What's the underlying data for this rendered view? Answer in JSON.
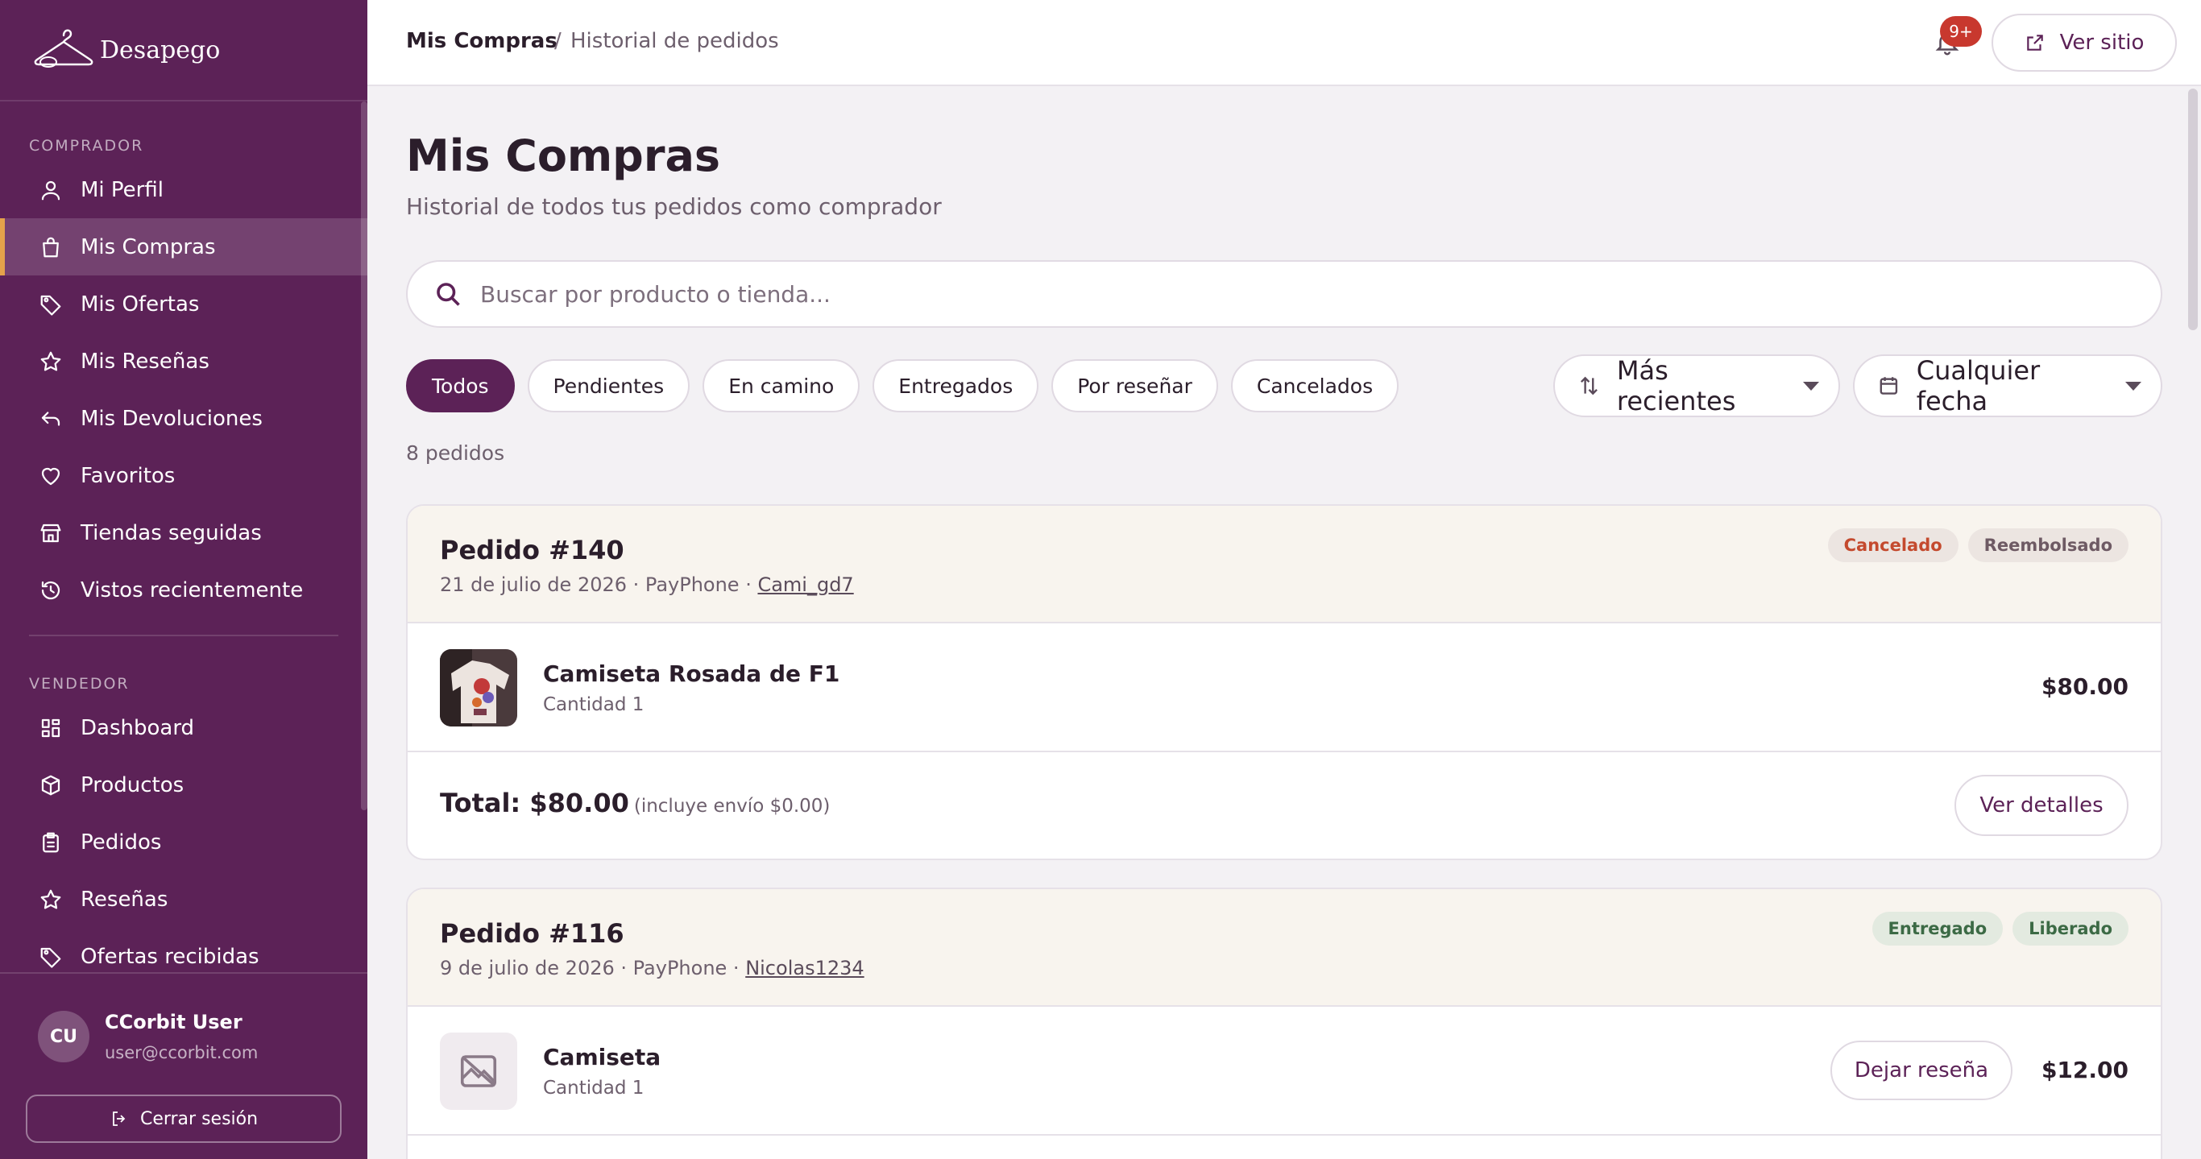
{
  "brand": {
    "name": "Desapego"
  },
  "sidebar": {
    "buyer_label": "COMPRADOR",
    "buyer_items": [
      {
        "label": "Mi Perfil",
        "icon": "user-icon"
      },
      {
        "label": "Mis Compras",
        "icon": "shopping-bag-icon",
        "active": true
      },
      {
        "label": "Mis Ofertas",
        "icon": "tag-icon"
      },
      {
        "label": "Mis Reseñas",
        "icon": "star-icon"
      },
      {
        "label": "Mis Devoluciones",
        "icon": "return-arrow-icon"
      },
      {
        "label": "Favoritos",
        "icon": "heart-icon"
      },
      {
        "label": "Tiendas seguidas",
        "icon": "store-icon"
      },
      {
        "label": "Vistos recientemente",
        "icon": "history-icon"
      }
    ],
    "seller_label": "VENDEDOR",
    "seller_items": [
      {
        "label": "Dashboard",
        "icon": "dashboard-icon"
      },
      {
        "label": "Productos",
        "icon": "box-icon"
      },
      {
        "label": "Pedidos",
        "icon": "clipboard-icon"
      },
      {
        "label": "Reseñas",
        "icon": "star-icon"
      },
      {
        "label": "Ofertas recibidas",
        "icon": "tag-icon"
      }
    ],
    "user": {
      "initials": "CU",
      "name": "CCorbit User",
      "email": "user@ccorbit.com"
    },
    "logout_label": "Cerrar sesión"
  },
  "header": {
    "breadcrumb_main": "Mis Compras",
    "breadcrumb_sep": "/",
    "breadcrumb_sub": "Historial de pedidos",
    "notifications_badge": "9+",
    "view_site_label": "Ver sitio"
  },
  "main": {
    "title": "Mis Compras",
    "subtitle": "Historial de todos tus pedidos como comprador",
    "search_placeholder": "Buscar por producto o tienda...",
    "filters": [
      "Todos",
      "Pendientes",
      "En camino",
      "Entregados",
      "Por reseñar",
      "Cancelados"
    ],
    "sort_label": "Más recientes",
    "date_label": "Cualquier fecha",
    "count_text": "8 pedidos"
  },
  "orders": [
    {
      "number": "Pedido #140",
      "date_payment": "21 de julio de 2026 · PayPhone · ",
      "seller": "Cami_gd7",
      "badges": [
        "Cancelado",
        "Reembolsado"
      ],
      "item": {
        "name": "Camiseta Rosada de F1",
        "qty": "Cantidad 1",
        "price": "$80.00"
      },
      "total": "Total: $80.00",
      "total_note": "(incluye envío $0.00)",
      "details_label": "Ver detalles"
    },
    {
      "number": "Pedido #116",
      "date_payment": "9 de julio de 2026 · PayPhone · ",
      "seller": "Nicolas1234",
      "badges": [
        "Entregado",
        "Liberado"
      ],
      "item": {
        "name": "Camiseta",
        "qty": "Cantidad 1",
        "price": "$12.00"
      },
      "review_label": "Dejar reseña"
    }
  ]
}
